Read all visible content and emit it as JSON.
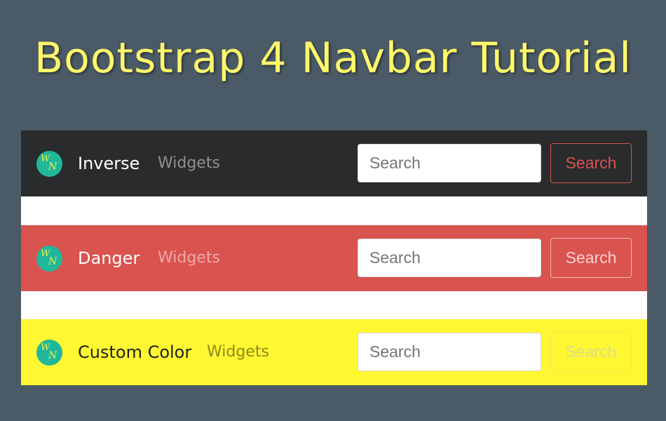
{
  "page": {
    "title": "Bootstrap 4 Navbar Tutorial",
    "background_color": "#4a5a66",
    "title_color": "#fdf86a"
  },
  "navbars": [
    {
      "variant": "inverse",
      "background_color": "#292b2c",
      "logo": {
        "icon": "wn-logo-icon",
        "letters": [
          "W",
          "N"
        ]
      },
      "brand": "Inverse",
      "links": [
        {
          "label": "Widgets"
        }
      ],
      "search": {
        "placeholder": "Search",
        "value": ""
      },
      "button_label": "Search",
      "button_color": "#d9534f"
    },
    {
      "variant": "danger",
      "background_color": "#d9534f",
      "logo": {
        "icon": "wn-logo-icon",
        "letters": [
          "W",
          "N"
        ]
      },
      "brand": "Danger",
      "links": [
        {
          "label": "Widgets"
        }
      ],
      "search": {
        "placeholder": "Search",
        "value": ""
      },
      "button_label": "Search",
      "button_color": "#f6d2d0"
    },
    {
      "variant": "custom",
      "background_color": "#fef731",
      "logo": {
        "icon": "wn-logo-icon",
        "letters": [
          "W",
          "N"
        ]
      },
      "brand": "Custom Color",
      "links": [
        {
          "label": "Widgets"
        }
      ],
      "search": {
        "placeholder": "Search",
        "value": ""
      },
      "button_label": "Search",
      "button_color": "#dcdc8a"
    }
  ]
}
